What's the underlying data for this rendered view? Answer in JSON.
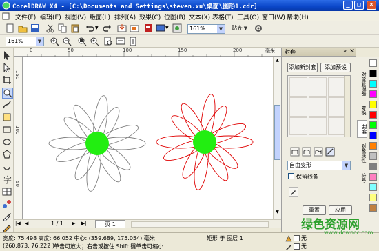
{
  "window": {
    "title": "CorelDRAW X4 - [C:\\Documents and Settings\\steven.xu\\桌面\\图形1.cdr]"
  },
  "menu": [
    "文件(F)",
    "编辑(E)",
    "视图(V)",
    "版面(L)",
    "排列(A)",
    "效果(C)",
    "位图(B)",
    "文本(X)",
    "表格(T)",
    "工具(O)",
    "窗口(W)",
    "帮助(H)"
  ],
  "toolbar1": {
    "zoom": "161%",
    "snap": "贴齐"
  },
  "toolbar2": {
    "zoom": "161%"
  },
  "ruler": {
    "h_ticks": [
      "0",
      "50",
      "100",
      "150",
      "200"
    ],
    "v_ticks": [
      "150",
      "100",
      "50"
    ],
    "unit": "毫米"
  },
  "canvas": {
    "left_flower_color": "#808080",
    "right_flower_color": "#e00000",
    "center_color": "#22ee11"
  },
  "pages": {
    "counter": "1 / 1",
    "tab": "页 1"
  },
  "docker": {
    "title": "封套",
    "add_new": "添加新封套",
    "add_preset": "添加预设",
    "mode": "自由变形",
    "keep_lines": "保留线条",
    "reset": "重置",
    "apply": "应用"
  },
  "side_tabs": [
    "对象管理器",
    "变换",
    "封套",
    "对象属性",
    "符号"
  ],
  "palette": [
    "#ffffff",
    "#000000",
    "#00ffff",
    "#ff00ff",
    "#ffff00",
    "#ff0000",
    "#00ff00",
    "#0000ff",
    "#ff8000",
    "#c0c0c0",
    "#808080",
    "#ff80c0",
    "#80ffff",
    "#ffff80",
    "#c08040"
  ],
  "status": {
    "size": "宽度: 75.498 高度: 66.052 中心: (359.689, 175.054) 毫米",
    "object": "矩形 于 图层 1",
    "coords": "(260.873, 76.222 )",
    "hint": "单击可放大；右击或按住 Shift 键单击可缩小",
    "fill": "无",
    "outline": "无"
  },
  "watermark": {
    "text": "绿色资源网",
    "url": "www.downcc.com"
  }
}
